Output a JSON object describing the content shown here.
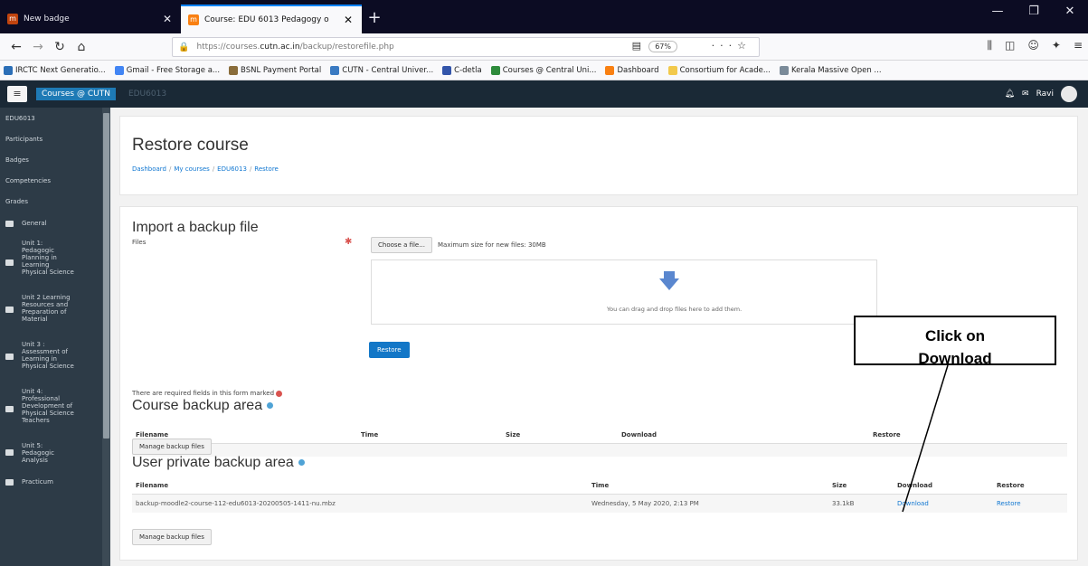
{
  "browser": {
    "tabs": [
      {
        "label": "New badge",
        "favicon_color": "#c1440e"
      },
      {
        "label": "Course: EDU 6013 Pedagogy o",
        "favicon_color": "#f98012"
      }
    ],
    "window_controls": [
      "—",
      "❐",
      "✕"
    ],
    "url_prefix": "https://courses.",
    "url_domain": "cutn.ac.in",
    "url_path": "/backup/restorefile.php",
    "zoom": "67%",
    "bookmarks": [
      "IRCTC Next Generatio...",
      "Gmail - Free Storage a...",
      "BSNL Payment Portal",
      "CUTN - Central Univer...",
      "C-detla",
      "Courses @ Central Uni...",
      "Dashboard",
      "Consortium for Acade...",
      "Kerala Massive Open ..."
    ]
  },
  "moodle_header": {
    "menu_icon": "≡",
    "site_name": "Courses @ CUTN",
    "dim_label": "EDU6013",
    "user_name": "Ravi"
  },
  "sidebar": {
    "top_items": [
      "EDU6013",
      "Participants",
      "Badges",
      "Competencies",
      "Grades"
    ],
    "sections": [
      "General",
      "Unit 1: Pedagogic Planning in Learning Physical Science",
      "Unit 2 Learning Resources and Preparation of Material",
      "Unit 3 : Assessment of Learning in Physical Science",
      "Unit 4: Professional Development of Physical Science Teachers",
      "Unit 5: Pedagogic Analysis",
      "Practicum"
    ]
  },
  "page": {
    "title": "Restore course",
    "breadcrumb": [
      "Dashboard",
      "My courses",
      "EDU6013",
      "Restore"
    ]
  },
  "import": {
    "title": "Import a backup file",
    "files_label": "Files",
    "choose_button": "Choose a file...",
    "max_size": "Maximum size for new files: 30MB",
    "drop_text": "You can drag and drop files here to add them.",
    "restore_button": "Restore",
    "required_note": "There are required fields in this form marked"
  },
  "course_backup": {
    "title": "Course backup area",
    "headers": [
      "Filename",
      "Time",
      "Size",
      "Download",
      "Restore"
    ],
    "manage_button": "Manage backup files"
  },
  "user_backup": {
    "title": "User private backup area",
    "headers": [
      "Filename",
      "Time",
      "Size",
      "Download",
      "Restore"
    ],
    "rows": [
      {
        "filename": "backup-moodle2-course-112-edu6013-20200505-1411-nu.mbz",
        "time": "Wednesday, 5 May 2020, 2:13 PM",
        "size": "33.1kB",
        "download": "Download",
        "restore": "Restore"
      }
    ],
    "manage_button": "Manage backup files"
  },
  "callout": {
    "line1": "Click on",
    "line2": "Download"
  }
}
